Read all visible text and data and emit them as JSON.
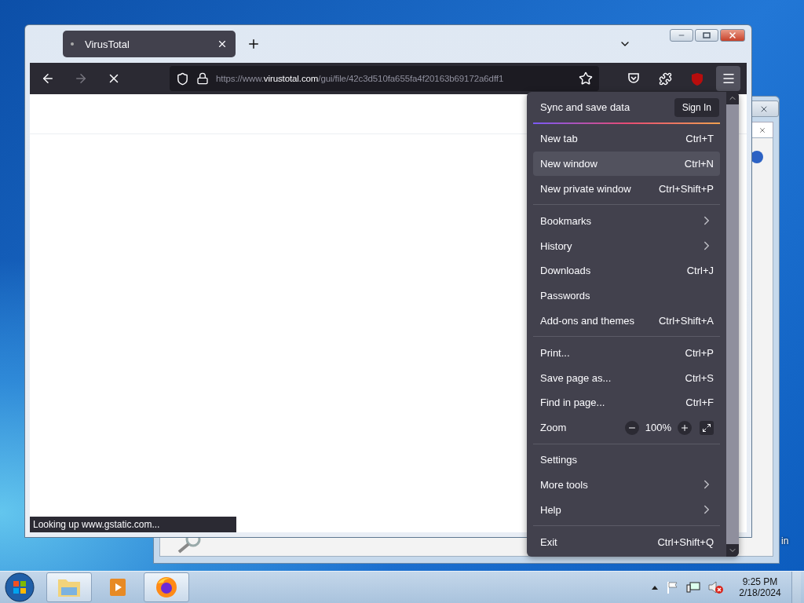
{
  "background_window": {
    "desktop_label": "in"
  },
  "browser": {
    "tab": {
      "title": "VirusTotal",
      "selected": true
    },
    "url": {
      "scheme": "https://www.",
      "domain": "virustotal.com",
      "path": "/gui/file/42c3d510fa655fa4f20163b69172a6dff1"
    },
    "loading": true,
    "status": "Looking up www.gstatic.com..."
  },
  "menu": {
    "sync": {
      "label": "Sync and save data",
      "button": "Sign In"
    },
    "groups": [
      [
        {
          "kind": "item",
          "label": "New tab",
          "shortcut": "Ctrl+T",
          "hovered": false
        },
        {
          "kind": "item",
          "label": "New window",
          "shortcut": "Ctrl+N",
          "hovered": true
        },
        {
          "kind": "item",
          "label": "New private window",
          "shortcut": "Ctrl+Shift+P",
          "hovered": false
        }
      ],
      [
        {
          "kind": "submenu",
          "label": "Bookmarks",
          "hovered": false
        },
        {
          "kind": "submenu",
          "label": "History",
          "hovered": false
        },
        {
          "kind": "item",
          "label": "Downloads",
          "shortcut": "Ctrl+J",
          "hovered": false
        },
        {
          "kind": "item",
          "label": "Passwords",
          "hovered": false
        },
        {
          "kind": "item",
          "label": "Add-ons and themes",
          "shortcut": "Ctrl+Shift+A",
          "hovered": false
        }
      ],
      [
        {
          "kind": "item",
          "label": "Print...",
          "shortcut": "Ctrl+P",
          "hovered": false
        },
        {
          "kind": "item",
          "label": "Save page as...",
          "shortcut": "Ctrl+S",
          "hovered": false
        },
        {
          "kind": "item",
          "label": "Find in page...",
          "shortcut": "Ctrl+F",
          "hovered": false
        },
        {
          "kind": "zoom",
          "label": "Zoom",
          "value": "100%",
          "hovered": false
        }
      ],
      [
        {
          "kind": "item",
          "label": "Settings",
          "hovered": false
        },
        {
          "kind": "submenu",
          "label": "More tools",
          "hovered": false
        },
        {
          "kind": "submenu",
          "label": "Help",
          "hovered": false
        }
      ],
      [
        {
          "kind": "item",
          "label": "Exit",
          "shortcut": "Ctrl+Shift+Q",
          "hovered": false
        }
      ]
    ]
  },
  "taskbar": {
    "apps": [
      {
        "kind": "explorer",
        "running": true
      },
      {
        "kind": "media",
        "running": false
      },
      {
        "kind": "firefox",
        "running": true
      }
    ],
    "clock": {
      "time": "9:25 PM",
      "date": "2/18/2024"
    }
  }
}
